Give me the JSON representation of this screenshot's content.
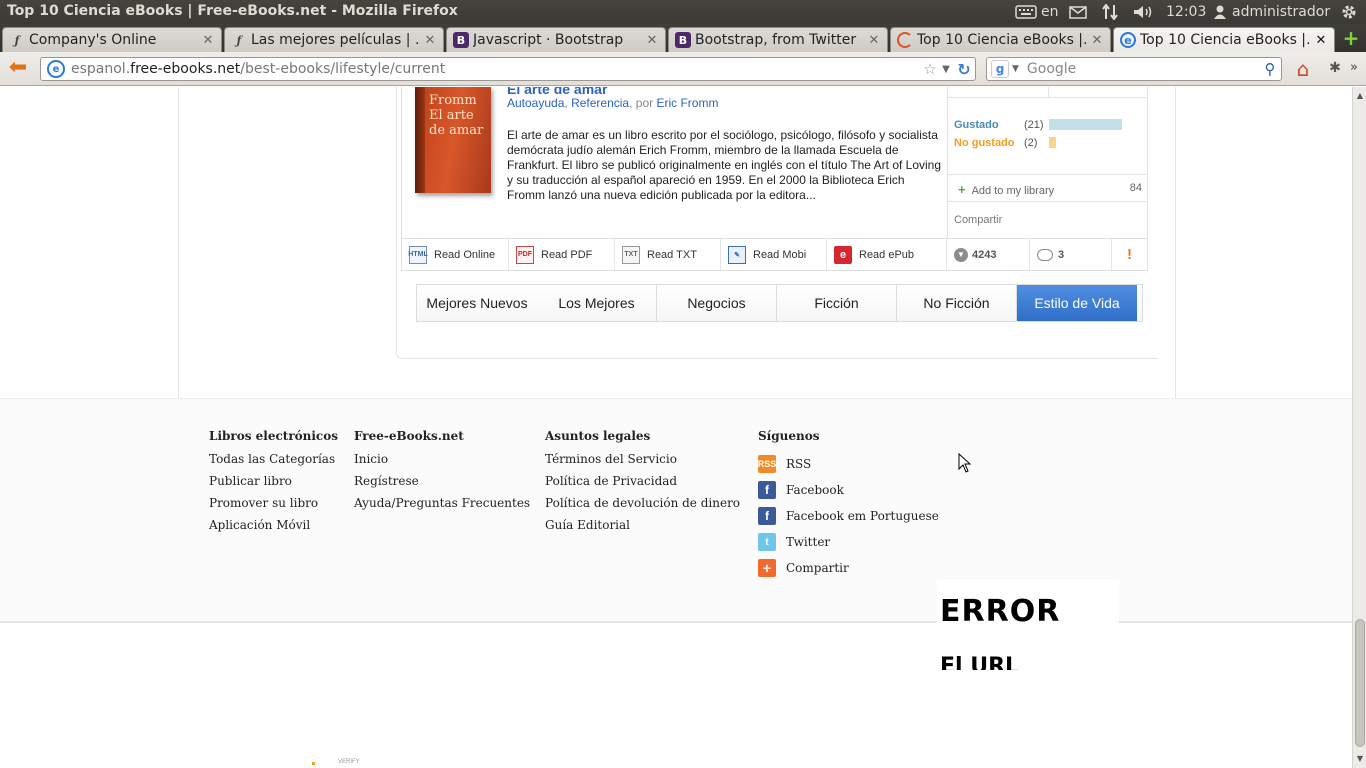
{
  "window": {
    "title": "Top 10 Ciencia eBooks | Free-eBooks.net - Mozilla Firefox"
  },
  "panel": {
    "keyboard_layout": "en",
    "clock": "12:03",
    "user": "administrador"
  },
  "tabs": [
    {
      "label": "Company's Online",
      "icon": "symfony-icon",
      "active": false
    },
    {
      "label": "Las mejores películas | …",
      "icon": "symfony-icon",
      "active": false
    },
    {
      "label": "Javascript · Bootstrap",
      "icon": "bootstrap-icon",
      "active": false
    },
    {
      "label": "Bootstrap, from Twitter",
      "icon": "bootstrap-icon",
      "active": false
    },
    {
      "label": "Top 10 Ciencia eBooks |…",
      "icon": "loading-icon",
      "active": false
    },
    {
      "label": "Top 10 Ciencia eBooks |…",
      "icon": "free-ebooks-icon",
      "active": true
    }
  ],
  "navbar": {
    "url_prefix": "espanol.",
    "url_domain": "free-ebooks.net",
    "url_path": "/best-ebooks/lifestyle/current",
    "search_placeholder": "Google"
  },
  "book": {
    "title": "El arte de amar",
    "categories": [
      "Autoayuda",
      "Referencia"
    ],
    "by_label": "por",
    "author": "Eric Fromm",
    "cover_text": "Fromm El arte de amar",
    "description": "El arte de amar es un libro escrito por el sociólogo, psicólogo, filósofo y socialista demócrata judío alemán Erich Fromm, miembro de la llamada Escuela de Frankfurt. El libro se publicó originalmente en inglés con el título The Art of Loving y su traducción al español apareció en 1959. En el 2000 la Biblioteca Erich Fromm lanzó una nueva edición publicada por la editora...",
    "votes": {
      "liked_label": "Gustado",
      "liked_count": "(21)",
      "disliked_label": "No gustado",
      "disliked_count": "(2)"
    },
    "add_library_label": "Add to my library",
    "library_count": "84",
    "share_label": "Compartir",
    "actions": [
      {
        "label": "Read Online",
        "icon": "html-icon"
      },
      {
        "label": "Read PDF",
        "icon": "pdf-icon"
      },
      {
        "label": "Read TXT",
        "icon": "txt-icon"
      },
      {
        "label": "Read Mobi",
        "icon": "mobi-icon"
      },
      {
        "label": "Read ePub",
        "icon": "epub-icon"
      }
    ],
    "downloads": "4243",
    "comments": "3",
    "report_label": "!"
  },
  "category_tabs": [
    {
      "label": "Mejores Nuevos",
      "active": false
    },
    {
      "label": "Los Mejores",
      "active": false
    },
    {
      "label": "Negocios",
      "active": false
    },
    {
      "label": "Ficción",
      "active": false
    },
    {
      "label": "No Ficción",
      "active": false
    },
    {
      "label": "Estilo de Vida",
      "active": true
    }
  ],
  "footer": {
    "col1": {
      "heading": "Libros electrónicos",
      "links": [
        "Todas las Categorías",
        "Publicar libro",
        "Promover su libro",
        "Aplicación Móvil"
      ]
    },
    "col2": {
      "heading": "Free-eBooks.net",
      "links": [
        "Inicio",
        "Regístrese",
        "Ayuda/Preguntas Frecuentes"
      ]
    },
    "col3": {
      "heading": "Asuntos legales",
      "links": [
        "Términos del Servicio",
        "Política de Privacidad",
        "Política de devolución de dinero",
        "Guía Editorial"
      ]
    },
    "col4": {
      "heading": "Síguenos",
      "links": [
        {
          "label": "RSS",
          "icon": "rss-icon"
        },
        {
          "label": "Facebook",
          "icon": "facebook-icon"
        },
        {
          "label": "Facebook em Portuguese",
          "icon": "facebook-icon"
        },
        {
          "label": "Twitter",
          "icon": "twitter-icon"
        },
        {
          "label": "Compartir",
          "icon": "share-plus-icon"
        }
      ]
    }
  },
  "error_overlay": {
    "line1": "ERROR",
    "line2": "El URL"
  },
  "seal_text": "VERIFY"
}
